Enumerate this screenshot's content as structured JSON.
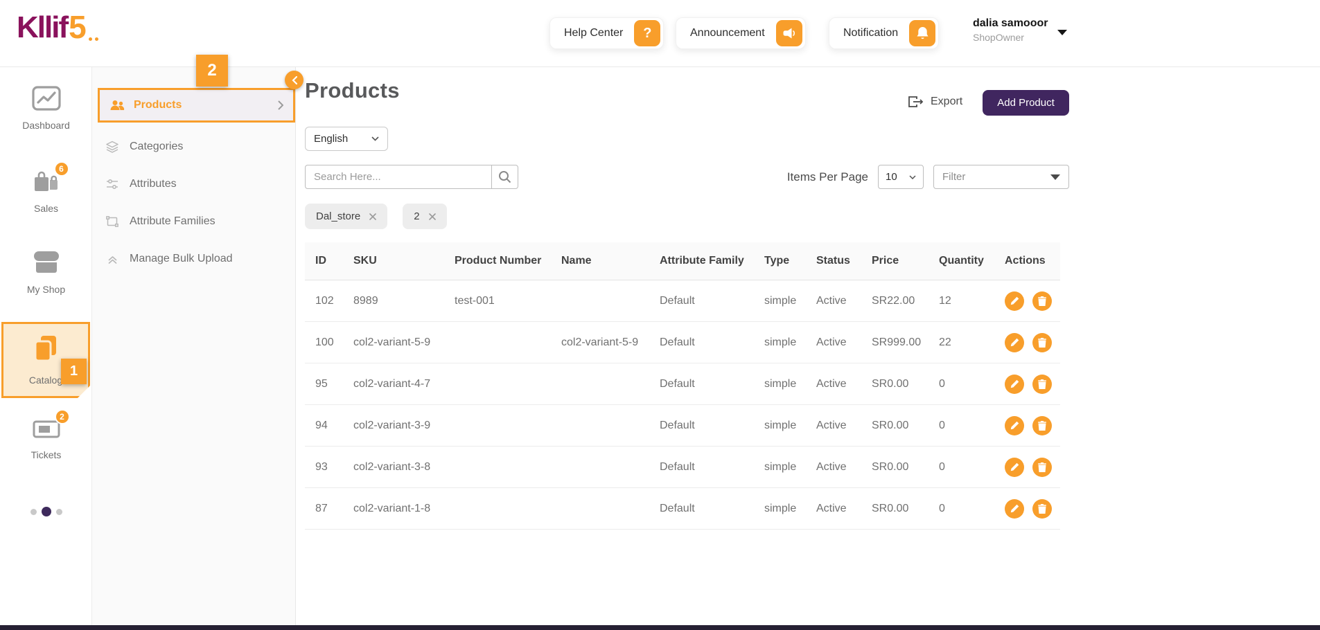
{
  "brand": {
    "logo_text": "Kllif",
    "logo_number": "5"
  },
  "header": {
    "help_center_label": "Help Center",
    "help_icon_glyph": "?",
    "announcement_label": "Announcement",
    "notification_label": "Notification",
    "user_name": "dalia samooor",
    "user_role": "ShopOwner"
  },
  "annotations": {
    "mark_1": "1",
    "mark_2": "2"
  },
  "sidebar": {
    "items": [
      {
        "label": "Dashboard",
        "icon": "line-chart-icon"
      },
      {
        "label": "Sales",
        "icon": "shopping-bags-icon",
        "badge": "6"
      },
      {
        "label": "My Shop",
        "icon": "storefront-icon"
      },
      {
        "label": "Catalog",
        "icon": "clipboard-icon"
      },
      {
        "label": "Tickets",
        "icon": "ticket-icon",
        "badge": "2"
      }
    ]
  },
  "submenu": {
    "items": [
      {
        "label": "Products",
        "icon": "users-icon",
        "selected": true
      },
      {
        "label": "Categories",
        "icon": "layers-icon"
      },
      {
        "label": "Attributes",
        "icon": "sliders-icon"
      },
      {
        "label": "Attribute Families",
        "icon": "object-group-icon"
      },
      {
        "label": "Manage Bulk Upload",
        "icon": "upload-icon"
      }
    ]
  },
  "main": {
    "title": "Products",
    "export_label": "Export",
    "add_product_label": "Add Product",
    "language_selected": "English",
    "search_placeholder": "Search Here...",
    "items_per_page_label": "Items Per Page",
    "items_per_page_selected": "10",
    "filter_label": "Filter",
    "chips": [
      {
        "label": "Dal_store"
      },
      {
        "label": "2"
      }
    ]
  },
  "table": {
    "headers": [
      "ID",
      "SKU",
      "Product Number",
      "Name",
      "Attribute Family",
      "Type",
      "Status",
      "Price",
      "Quantity",
      "Actions"
    ],
    "rows": [
      {
        "id": "102",
        "sku": "8989",
        "product_number": "test-001",
        "name": "",
        "attribute_family": "Default",
        "type": "simple",
        "status": "Active",
        "price": "SR22.00",
        "quantity": "12"
      },
      {
        "id": "100",
        "sku": "col2-variant-5-9",
        "product_number": "",
        "name": "col2-variant-5-9",
        "attribute_family": "Default",
        "type": "simple",
        "status": "Active",
        "price": "SR999.00",
        "quantity": "22"
      },
      {
        "id": "95",
        "sku": "col2-variant-4-7",
        "product_number": "",
        "name": "",
        "attribute_family": "Default",
        "type": "simple",
        "status": "Active",
        "price": "SR0.00",
        "quantity": "0"
      },
      {
        "id": "94",
        "sku": "col2-variant-3-9",
        "product_number": "",
        "name": "",
        "attribute_family": "Default",
        "type": "simple",
        "status": "Active",
        "price": "SR0.00",
        "quantity": "0"
      },
      {
        "id": "93",
        "sku": "col2-variant-3-8",
        "product_number": "",
        "name": "",
        "attribute_family": "Default",
        "type": "simple",
        "status": "Active",
        "price": "SR0.00",
        "quantity": "0"
      },
      {
        "id": "87",
        "sku": "col2-variant-1-8",
        "product_number": "",
        "name": "",
        "attribute_family": "Default",
        "type": "simple",
        "status": "Active",
        "price": "SR0.00",
        "quantity": "0"
      }
    ]
  },
  "colors": {
    "accent_orange": "#F89E2B",
    "brand_magenta": "#8A125C",
    "button_purple": "#40265F",
    "catalog_highlight_bg": "#FCEBD0",
    "selected_item_bg": "#F2EFF3"
  }
}
